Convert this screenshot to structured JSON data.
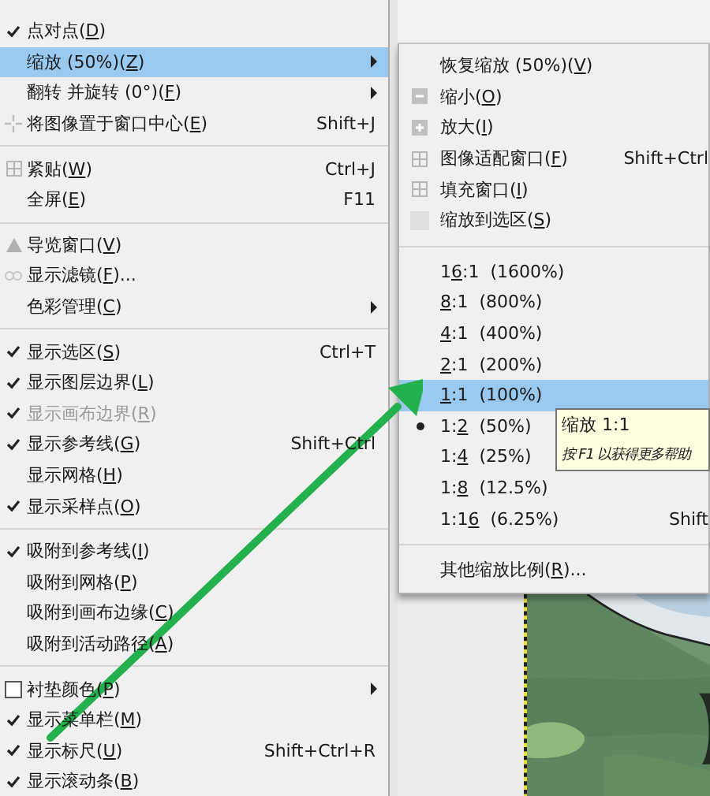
{
  "view_menu": {
    "items": [
      {
        "kind": "check",
        "pre": "点对点(",
        "key": "D",
        "post": ")",
        "checked": true,
        "highlighted": false,
        "disabled": false,
        "submenu": false
      },
      {
        "kind": "plain",
        "pre": "缩放 (50%)(",
        "key": "Z",
        "post": ")",
        "highlighted": true,
        "disabled": false,
        "submenu": true
      },
      {
        "kind": "plain",
        "pre": "翻转 并旋转 (0°)(",
        "key": "F",
        "post": ")",
        "highlighted": false,
        "disabled": false,
        "submenu": true
      },
      {
        "kind": "center",
        "pre": "将图像置于窗口中心(",
        "key": "E",
        "post": ")",
        "shortcut": "Shift+J",
        "highlighted": false,
        "disabled": false,
        "submenu": false
      },
      {
        "kind": "separator"
      },
      {
        "kind": "grid",
        "pre": "紧贴(",
        "key": "W",
        "post": ")",
        "shortcut": "Ctrl+J",
        "highlighted": false,
        "disabled": false,
        "submenu": false
      },
      {
        "kind": "plain",
        "pre": "全屏(",
        "key": "E",
        "post": ")",
        "shortcut": "F11",
        "highlighted": false,
        "disabled": false,
        "submenu": false
      },
      {
        "kind": "separator"
      },
      {
        "kind": "navigate",
        "pre": "导览窗口(",
        "key": "V",
        "post": ")",
        "highlighted": false,
        "disabled": false,
        "submenu": false
      },
      {
        "kind": "filter",
        "pre": "显示滤镜(",
        "key": "F",
        "post": ")...",
        "highlighted": false,
        "disabled": false,
        "submenu": false
      },
      {
        "kind": "plain",
        "pre": "色彩管理(",
        "key": "C",
        "post": ")",
        "highlighted": false,
        "disabled": false,
        "submenu": true
      },
      {
        "kind": "separator"
      },
      {
        "kind": "check",
        "pre": "显示选区(",
        "key": "S",
        "post": ")",
        "shortcut": "Ctrl+T",
        "checked": true,
        "highlighted": false,
        "disabled": false,
        "submenu": false
      },
      {
        "kind": "check",
        "pre": "显示图层边界(",
        "key": "L",
        "post": ")",
        "checked": true,
        "highlighted": false,
        "disabled": false,
        "submenu": false
      },
      {
        "kind": "check",
        "pre": "显示画布边界(",
        "key": "R",
        "post": ")",
        "checked": true,
        "highlighted": false,
        "disabled": true,
        "submenu": false
      },
      {
        "kind": "check",
        "pre": "显示参考线(",
        "key": "G",
        "post": ")",
        "shortcut": "Shift+Ctrl",
        "checked": true,
        "highlighted": false,
        "disabled": false,
        "submenu": false
      },
      {
        "kind": "check",
        "pre": "显示网格(",
        "key": "H",
        "post": ")",
        "checked": false,
        "highlighted": false,
        "disabled": false,
        "submenu": false
      },
      {
        "kind": "check",
        "pre": "显示采样点(",
        "key": "O",
        "post": ")",
        "checked": true,
        "highlighted": false,
        "disabled": false,
        "submenu": false
      },
      {
        "kind": "separator"
      },
      {
        "kind": "check",
        "pre": "吸附到参考线(",
        "key": "I",
        "post": ")",
        "checked": true,
        "highlighted": false,
        "disabled": false,
        "submenu": false
      },
      {
        "kind": "check",
        "pre": "吸附到网格(",
        "key": "P",
        "post": ")",
        "checked": false,
        "highlighted": false,
        "disabled": false,
        "submenu": false
      },
      {
        "kind": "check",
        "pre": "吸附到画布边缘(",
        "key": "C",
        "post": ")",
        "checked": false,
        "highlighted": false,
        "disabled": false,
        "submenu": false
      },
      {
        "kind": "check",
        "pre": "吸附到活动路径(",
        "key": "A",
        "post": ")",
        "checked": false,
        "highlighted": false,
        "disabled": false,
        "submenu": false
      },
      {
        "kind": "separator"
      },
      {
        "kind": "checkbox",
        "pre": "衬垫颜色(",
        "key": "P",
        "post": ")",
        "checked": false,
        "highlighted": false,
        "disabled": false,
        "submenu": true
      },
      {
        "kind": "check",
        "pre": "显示菜单栏(",
        "key": "M",
        "post": ")",
        "checked": true,
        "highlighted": false,
        "disabled": false,
        "submenu": false
      },
      {
        "kind": "check",
        "pre": "显示标尺(",
        "key": "U",
        "post": ")",
        "shortcut": "Shift+Ctrl+R",
        "checked": true,
        "highlighted": false,
        "disabled": false,
        "submenu": false
      },
      {
        "kind": "check",
        "pre": "显示滚动条(",
        "key": "B",
        "post": ")",
        "checked": true,
        "highlighted": false,
        "disabled": false,
        "submenu": false
      }
    ]
  },
  "zoom_menu": {
    "items": [
      {
        "kind": "plain",
        "pre": "恢复缩放 (50%)(",
        "key": "V",
        "post": ")",
        "highlighted": false
      },
      {
        "kind": "zoomout",
        "pre": "缩小(",
        "key": "O",
        "post": ")",
        "highlighted": false
      },
      {
        "kind": "zoomin",
        "pre": "放大(",
        "key": "I",
        "post": ")",
        "highlighted": false
      },
      {
        "kind": "grid",
        "pre": "图像适配窗口(",
        "key": "F",
        "post": ")",
        "shortcut": "Shift+Ctrl",
        "highlighted": false
      },
      {
        "kind": "grid",
        "pre": "填充窗口(",
        "key": "I",
        "post": ")",
        "highlighted": false
      },
      {
        "kind": "selection",
        "pre": "缩放到选区(",
        "key": "S",
        "post": ")",
        "highlighted": false
      },
      {
        "kind": "separator"
      },
      {
        "kind": "radio",
        "pre": "1",
        "key": "6",
        "post": ":1  (1600%)",
        "selected": false,
        "highlighted": false
      },
      {
        "kind": "radio",
        "key": "8",
        "post": ":1  (800%)",
        "selected": false,
        "highlighted": false
      },
      {
        "kind": "radio",
        "key": "4",
        "post": ":1  (400%)",
        "selected": false,
        "highlighted": false
      },
      {
        "kind": "radio",
        "key": "2",
        "post": ":1  (200%)",
        "selected": false,
        "highlighted": false
      },
      {
        "kind": "radio",
        "key": "1",
        "post": ":1  (100%)",
        "selected": false,
        "highlighted": true
      },
      {
        "kind": "radio",
        "pre": "1:",
        "key": "2",
        "post": "  (50%)",
        "selected": true,
        "highlighted": false
      },
      {
        "kind": "radio",
        "pre": "1:",
        "key": "4",
        "post": "  (25%)",
        "selected": false,
        "highlighted": false
      },
      {
        "kind": "radio",
        "pre": "1:",
        "key": "8",
        "post": "  (12.5%)",
        "selected": false,
        "highlighted": false
      },
      {
        "kind": "radio",
        "pre": "1:1",
        "key": "6",
        "post": "  (6.25%)",
        "shortcut": "Shift",
        "selected": false,
        "highlighted": false
      },
      {
        "kind": "separator"
      },
      {
        "kind": "plain",
        "pre": "其他缩放比例(",
        "key": "R",
        "post": ")...",
        "highlighted": false
      }
    ]
  },
  "tooltip": {
    "title": "缩放 1:1",
    "hint": "按 F1 以获得更多帮助"
  }
}
